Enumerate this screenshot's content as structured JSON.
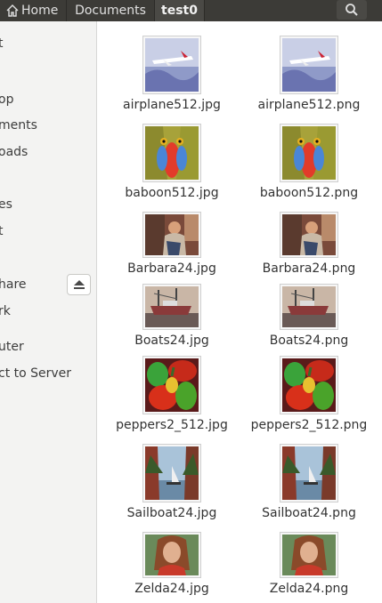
{
  "breadcrumb": {
    "home": "Home",
    "documents": "Documents",
    "current": "test0"
  },
  "sidebar": {
    "items": [
      "t",
      "op",
      "ments",
      "oads",
      "es",
      "t",
      "hare",
      "rk",
      "uter",
      "ct to Server"
    ]
  },
  "files": [
    {
      "name": "airplane512.jpg",
      "thumb": "airplane"
    },
    {
      "name": "airplane512.png",
      "thumb": "airplane"
    },
    {
      "name": "baboon512.jpg",
      "thumb": "baboon"
    },
    {
      "name": "baboon512.png",
      "thumb": "baboon"
    },
    {
      "name": "Barbara24.jpg",
      "thumb": "barbara"
    },
    {
      "name": "Barbara24.png",
      "thumb": "barbara"
    },
    {
      "name": "Boats24.jpg",
      "thumb": "boats"
    },
    {
      "name": "Boats24.png",
      "thumb": "boats"
    },
    {
      "name": "peppers2_512.jpg",
      "thumb": "peppers"
    },
    {
      "name": "peppers2_512.png",
      "thumb": "peppers"
    },
    {
      "name": "Sailboat24.jpg",
      "thumb": "sailboat"
    },
    {
      "name": "Sailboat24.png",
      "thumb": "sailboat"
    },
    {
      "name": "Zelda24.jpg",
      "thumb": "zelda"
    },
    {
      "name": "Zelda24.png",
      "thumb": "zelda"
    }
  ],
  "colors": {
    "toolbar": "#3c3b37",
    "sidebar": "#f3f3f2",
    "text": "#333333"
  }
}
